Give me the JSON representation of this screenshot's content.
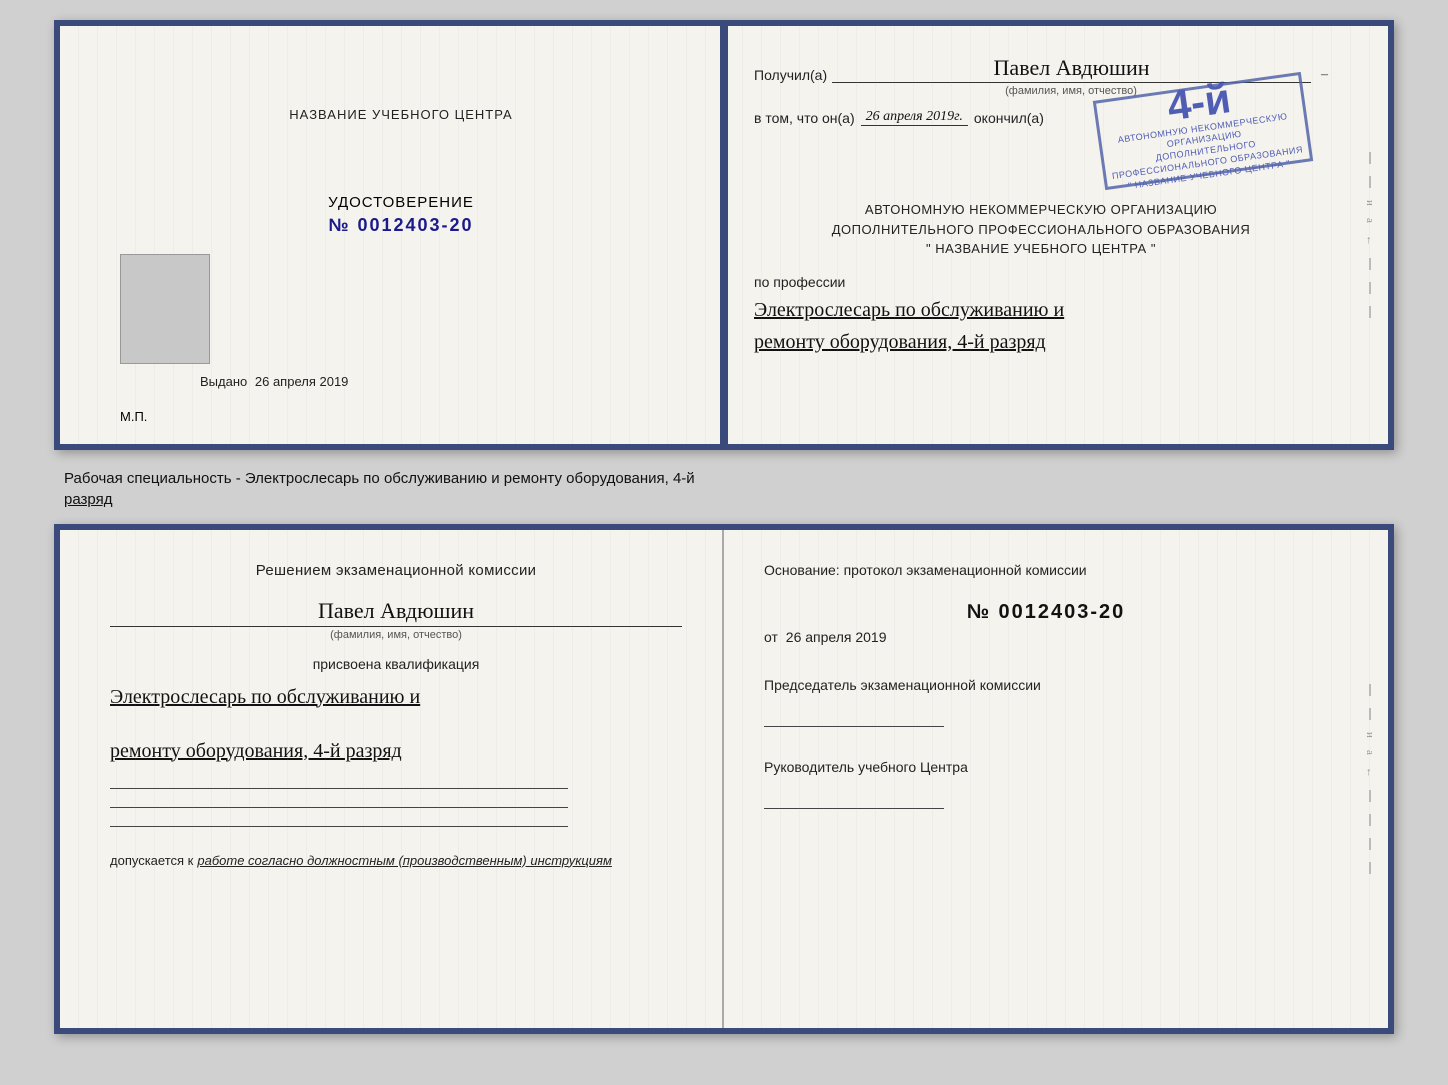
{
  "background": "#d0d0d0",
  "doc_top": {
    "left": {
      "training_center_label": "НАЗВАНИЕ УЧЕБНОГО ЦЕНТРА",
      "udostoverenie_label": "УДОСТОВЕРЕНИЕ",
      "number": "№ 0012403-20",
      "vydano_label": "Выдано",
      "vydano_date": "26 апреля 2019",
      "mp_label": "М.П."
    },
    "right": {
      "poluchil_label": "Получил(a)",
      "name": "Павел Авдюшин",
      "fio_label": "(фамилия, имя, отчество)",
      "vtom_label": "в том, что он(a)",
      "vtom_date": "26 апреля 2019г.",
      "okonchil_label": "окончил(a)",
      "stamp_num": "4-й",
      "stamp_line1": "АВТОНОМНУЮ НЕКОММЕРЧЕСКУЮ ОРГАНИЗАЦИЮ",
      "stamp_line2": "ДОПОЛНИТЕЛЬНОГО ПРОФЕССИОНАЛЬНОГО ОБРАЗОВАНИЯ",
      "stamp_line3": "\" НАЗВАНИЕ УЧЕБНОГО ЦЕНТРА \"",
      "po_professii_label": "по профессии",
      "profession1": "Электрослесарь по обслуживанию и",
      "profession2": "ремонту оборудования, 4-й разряд"
    }
  },
  "middle_text": {
    "line1": "Рабочая специальность - Электрослесарь по обслуживанию и ремонту оборудования, 4-й",
    "line2": "разряд"
  },
  "doc_bottom": {
    "left": {
      "resheniyem_label": "Решением экзаменационной комиссии",
      "name": "Павел Авдюшин",
      "fio_label": "(фамилия, имя, отчество)",
      "prisvoena_label": "присвоена квалификация",
      "profession1": "Электрослесарь по обслуживанию и",
      "profession2": "ремонту оборудования, 4-й разряд",
      "dopuskaetsya_label": "допускается к",
      "dopuskaetsya_value": "работе согласно должностным (производственным) инструкциям"
    },
    "right": {
      "osnovanie_label": "Основание: протокол экзаменационной комиссии",
      "protokol_num": "№ 0012403-20",
      "ot_label": "от",
      "ot_date": "26 апреля 2019",
      "predsedatel_label": "Председатель экзаменационной комиссии",
      "rukovoditel_label": "Руководитель учебного Центра"
    },
    "side": {
      "letters": [
        "и",
        "а",
        "←"
      ]
    }
  }
}
